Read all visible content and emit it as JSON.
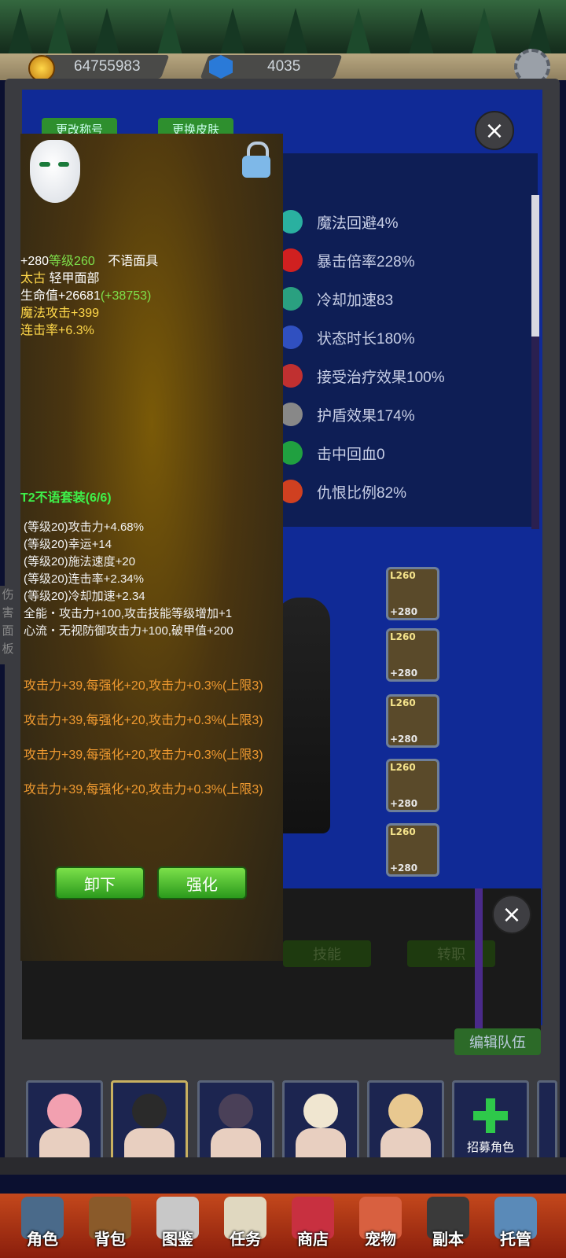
{
  "currency": {
    "gold": "64755983",
    "gems": "4035"
  },
  "top_buttons": {
    "rename": "更改称号",
    "skin": "更换皮肤"
  },
  "side_tab": "伤害面板",
  "stats": [
    {
      "label": "魔法回避4%",
      "icon": "evasion-icon",
      "color": "#2ab0a0"
    },
    {
      "label": "暴击倍率228%",
      "icon": "crit-icon",
      "color": "#d02020"
    },
    {
      "label": "冷却加速83",
      "icon": "cooldown-icon",
      "color": "#2aa080"
    },
    {
      "label": "状态时长180%",
      "icon": "duration-icon",
      "color": "#3050c0"
    },
    {
      "label": "接受治疗效果100%",
      "icon": "heal-received-icon",
      "color": "#c03030"
    },
    {
      "label": "护盾效果174%",
      "icon": "shield-icon",
      "color": "#888888"
    },
    {
      "label": "击中回血0",
      "icon": "lifesteal-icon",
      "color": "#20a040"
    },
    {
      "label": "仇恨比例82%",
      "icon": "threat-icon",
      "color": "#d04020"
    }
  ],
  "item": {
    "plus": "+280",
    "level": "等级260",
    "name": "不语面具",
    "tier": "太古",
    "type": "轻甲面部",
    "hp": "生命值+26681",
    "hp_bonus": "(+38753)",
    "magic_atk": "魔法攻击+399",
    "combo": "连击率+6.3%",
    "set_title": "T2不语套装(6/6)",
    "set_bonuses": [
      "(等级20)攻击力+4.68%",
      "(等级20)幸运+14",
      "(等级20)施法速度+20",
      "(等级20)连击率+2.34%",
      "(等级20)冷却加速+2.34",
      "全能・攻击力+100,攻击技能等级增加+1",
      "心流・无视防御攻击力+100,破甲值+200"
    ],
    "enhance_lines": [
      "攻击力+39,每强化+20,攻击力+0.3%(上限3)",
      "攻击力+39,每强化+20,攻击力+0.3%(上限3)",
      "攻击力+39,每强化+20,攻击力+0.3%(上限3)",
      "攻击力+39,每强化+20,攻击力+0.3%(上限3)"
    ],
    "unequip": "卸下",
    "enhance": "强化"
  },
  "equip_slots": [
    {
      "lvl": "L260",
      "plus": "+280"
    },
    {
      "lvl": "L260",
      "plus": "+280"
    },
    {
      "lvl": "L260",
      "plus": "+280"
    },
    {
      "lvl": "L260",
      "plus": "+280"
    },
    {
      "lvl": "L260",
      "plus": "+280"
    }
  ],
  "lower_buttons": {
    "skill": "技能",
    "job": "转职",
    "edit_team": "编辑队伍"
  },
  "recruit": "招募角色",
  "nav": [
    "角色",
    "背包",
    "图鉴",
    "任务",
    "商店",
    "宠物",
    "副本",
    "托管"
  ]
}
